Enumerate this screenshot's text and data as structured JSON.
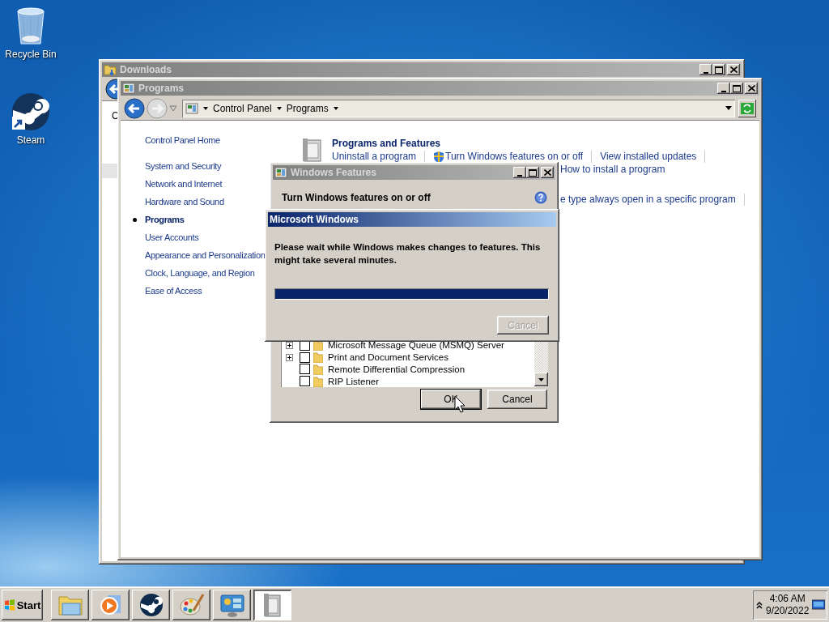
{
  "desktop_icons": [
    {
      "kind": "recycle-bin",
      "label": "Recycle Bin"
    },
    {
      "kind": "steam",
      "label": "Steam"
    }
  ],
  "downloads_window": {
    "title": "Downloads",
    "active": false,
    "pane_text": "C"
  },
  "programs_window": {
    "title": "Programs",
    "active": false,
    "breadcrumb": [
      "Control Panel",
      "Programs"
    ],
    "sidebar": {
      "home": "Control Panel Home",
      "items": [
        {
          "label": "System and Security",
          "selected": false
        },
        {
          "label": "Network and Internet",
          "selected": false
        },
        {
          "label": "Hardware and Sound",
          "selected": false
        },
        {
          "label": "Programs",
          "selected": true
        },
        {
          "label": "User Accounts",
          "selected": false
        },
        {
          "label": "Appearance and Personalization",
          "selected": false
        },
        {
          "label": "Clock, Language, and Region",
          "selected": false
        },
        {
          "label": "Ease of Access",
          "selected": false
        }
      ]
    },
    "section": {
      "title": "Programs and Features",
      "links": [
        {
          "label": "Uninstall a program",
          "shield": false
        },
        {
          "label": "Turn Windows features on or off",
          "shield": true
        },
        {
          "label": "View installed updates",
          "shield": false
        }
      ],
      "more_link": "How to install a program"
    },
    "next_section_text": "e type always open in a specific program"
  },
  "features_dialog": {
    "title": "Windows Features",
    "active": false,
    "heading": "Turn Windows features on or off",
    "features": [
      {
        "label": "Microsoft Message Queue (MSMQ) Server",
        "expandable": true,
        "checked": false
      },
      {
        "label": "Print and Document Services",
        "expandable": true,
        "checked": false
      },
      {
        "label": "Remote Differential Compression",
        "expandable": false,
        "checked": false
      },
      {
        "label": "RIP Listener",
        "expandable": false,
        "checked": false
      }
    ],
    "buttons": [
      {
        "label": "OK",
        "default": true
      },
      {
        "label": "Cancel",
        "default": false
      }
    ]
  },
  "progress_dialog": {
    "title": "Microsoft Windows",
    "active": true,
    "message": "Please wait while Windows makes changes to features. This might take several minutes.",
    "level": 1,
    "cancel": {
      "label": "Cancel",
      "disabled": true
    }
  },
  "taskbar": {
    "start": "Start",
    "buttons": [
      {
        "kind": "explorer",
        "selected": false
      },
      {
        "kind": "media-player",
        "selected": false
      },
      {
        "kind": "steam",
        "selected": false
      },
      {
        "kind": "paint",
        "selected": false
      },
      {
        "kind": "control-panel",
        "selected": false
      },
      {
        "kind": "installer",
        "selected": true
      }
    ],
    "clock": {
      "time": "4:06 AM",
      "date": "9/20/2022"
    }
  }
}
